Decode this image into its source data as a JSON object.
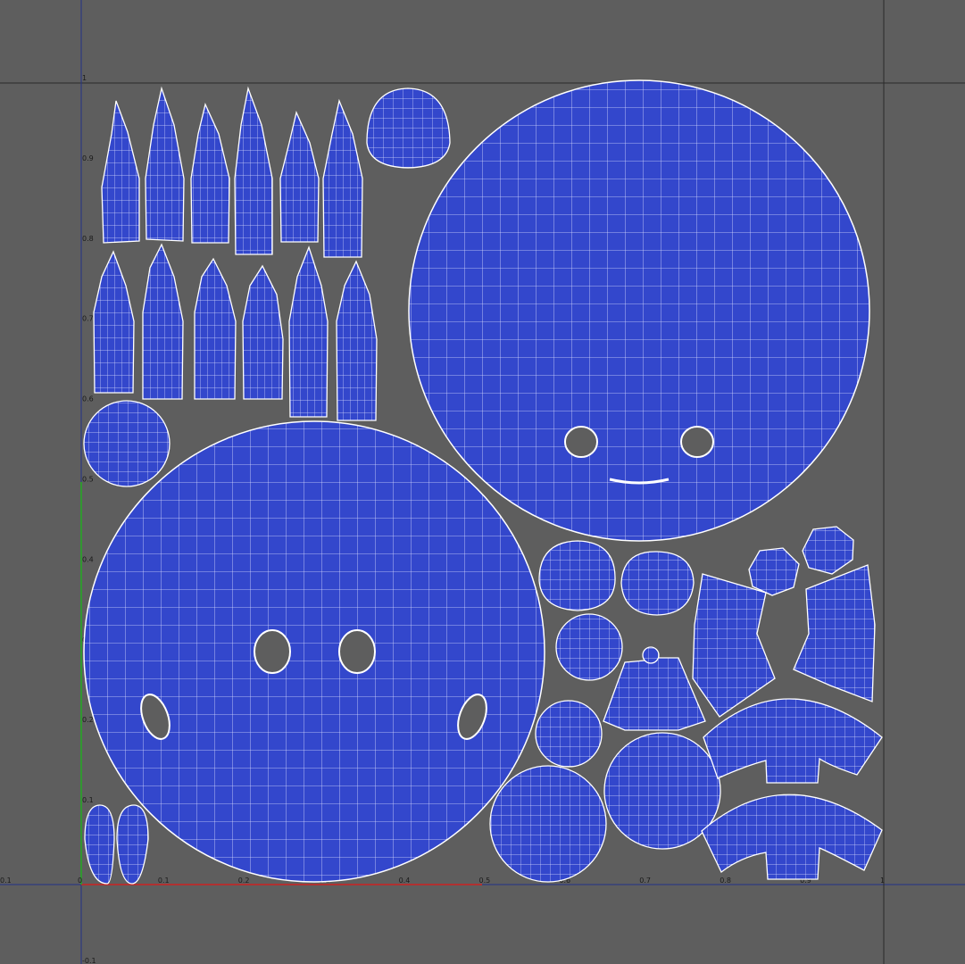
{
  "app": {
    "view": "UV texture editor",
    "colors": {
      "background": "#5e5e5e",
      "uv_shell_fill": "#3347cc",
      "uv_wire": "#ffffff",
      "grid_line": "#2a2a2a",
      "u_axis": "#cc2222",
      "v_axis": "#22aa22",
      "frame_line": "#223388"
    }
  },
  "axes": {
    "u_ticks": [
      "-0.1",
      "0",
      "0.1",
      "0.2",
      "0.3",
      "0.4",
      "0.5",
      "0.6",
      "0.7",
      "0.8",
      "0.9",
      "1"
    ],
    "v_ticks": [
      "-0.1",
      "0.1",
      "0.2",
      "0.3",
      "0.4",
      "0.5",
      "0.6",
      "0.7",
      "0.8",
      "0.9",
      "1"
    ]
  },
  "uv_shells": {
    "large_head": "large-round-shell",
    "body": "large-face-shell",
    "teeth_row_top": "claw-shells-row-1",
    "teeth_row_bottom": "claw-shells-row-2",
    "eyes": "small-disc-shells",
    "strips": "curved-strip-shells"
  }
}
